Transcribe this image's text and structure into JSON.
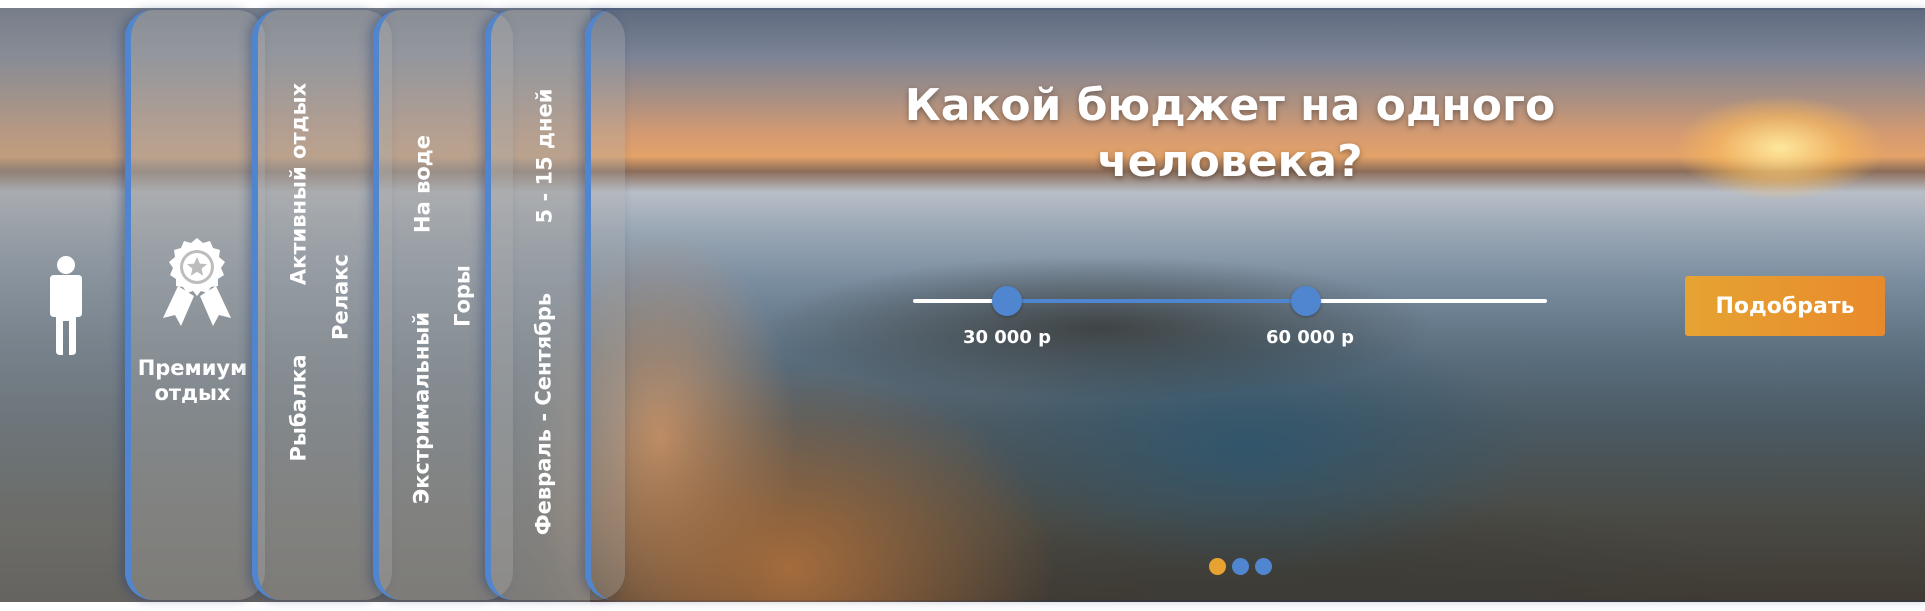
{
  "sidebar": {
    "premium_label_line1": "Премиум",
    "premium_label_line2": "отдых",
    "panel_types": {
      "active": "Активный отдых",
      "relax": "Релакс",
      "fishing": "Рыбалка"
    },
    "panel_terrain": {
      "water": "На воде",
      "mountains": "Горы",
      "extreme": "Экстримальный"
    },
    "panel_duration": {
      "days": "5 - 15 дней",
      "months": "Февраль - Сентябрь"
    }
  },
  "main": {
    "question": "Какой бюджет на одного человека?",
    "slider": {
      "min_label": "30 000 р",
      "max_label": "60 000 р",
      "min_value": 30000,
      "max_value": 60000
    },
    "submit_label": "Подобрать",
    "pagination": {
      "count": 3,
      "active_index": 0
    }
  },
  "colors": {
    "accent_blue": "#4f86cf",
    "accent_orange": "#e6a332"
  },
  "icons": [
    "person-icon",
    "award-ribbon-icon"
  ]
}
